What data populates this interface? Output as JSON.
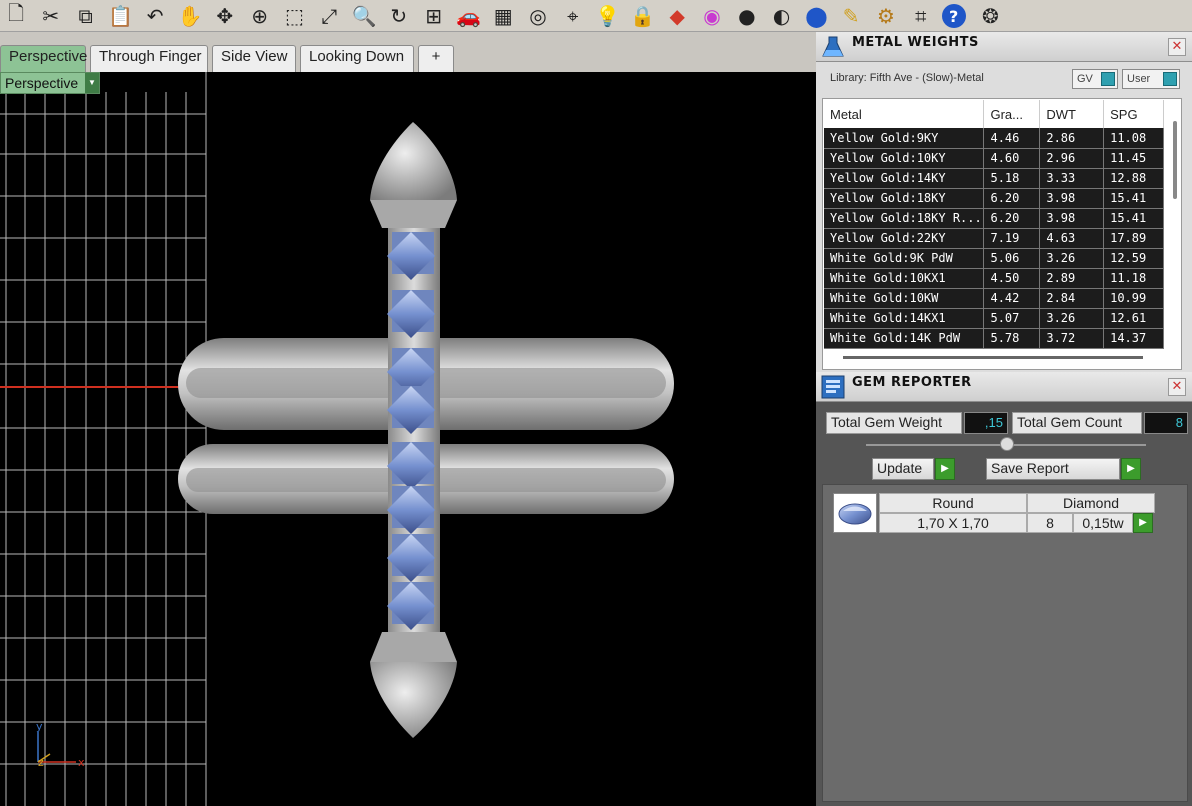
{
  "toolbar": {
    "icons": [
      "new-file-icon",
      "cut-icon",
      "copy-icon",
      "paste-icon",
      "undo-icon",
      "pan-hand-icon",
      "move-icon",
      "zoom-in-icon",
      "zoom-window-icon",
      "zoom-extents-icon",
      "zoom-selected-icon",
      "rotate-view-icon",
      "four-viewports-icon",
      "car-icon",
      "grid-icon",
      "target-icon",
      "snap-icon",
      "bulb-icon",
      "lock-icon",
      "render-icon",
      "color-wheel-icon",
      "sphere-gray-icon",
      "sphere-shaded-icon",
      "sphere-blue-icon",
      "pencil-icon",
      "gear-icon",
      "crop-icon",
      "help-icon",
      "color-palette-icon"
    ]
  },
  "tabs": [
    {
      "label": "Perspective",
      "active": true
    },
    {
      "label": "Through Finger",
      "active": false
    },
    {
      "label": "Side View",
      "active": false
    },
    {
      "label": "Looking Down",
      "active": false
    },
    {
      "label": "+",
      "active": false
    }
  ],
  "viewport": {
    "label": "Perspective",
    "axis_y": "y",
    "axis_x": "x",
    "axis_z": "z"
  },
  "metal_weights": {
    "title": "METAL WEIGHTS",
    "library": "Library: Fifth Ave - (Slow)-Metal",
    "toggle_gv": "GV",
    "toggle_user": "User",
    "columns": [
      "Metal",
      "Gra...",
      "DWT",
      "SPG"
    ],
    "rows": [
      [
        "Yellow Gold:9KY",
        "4.46",
        "2.86",
        "11.08"
      ],
      [
        "Yellow Gold:10KY",
        "4.60",
        "2.96",
        "11.45"
      ],
      [
        "Yellow Gold:14KY",
        "5.18",
        "3.33",
        "12.88"
      ],
      [
        "Yellow Gold:18KY",
        "6.20",
        "3.98",
        "15.41"
      ],
      [
        "Yellow Gold:18KY R...",
        "6.20",
        "3.98",
        "15.41"
      ],
      [
        "Yellow Gold:22KY",
        "7.19",
        "4.63",
        "17.89"
      ],
      [
        "White Gold:9K PdW",
        "5.06",
        "3.26",
        "12.59"
      ],
      [
        "White Gold:10KX1",
        "4.50",
        "2.89",
        "11.18"
      ],
      [
        "White Gold:10KW",
        "4.42",
        "2.84",
        "10.99"
      ],
      [
        "White Gold:14KX1",
        "5.07",
        "3.26",
        "12.61"
      ],
      [
        "White Gold:14K PdW",
        "5.78",
        "3.72",
        "14.37"
      ]
    ]
  },
  "gem_reporter": {
    "title": "GEM REPORTER",
    "total_weight_label": "Total Gem Weight",
    "total_weight_value": ",15",
    "total_count_label": "Total Gem Count",
    "total_count_value": "8",
    "update_label": "Update",
    "save_report_label": "Save Report",
    "gem": {
      "shape": "Round",
      "material": "Diamond",
      "size": "1,70 X 1,70",
      "count": "8",
      "weight": "0,15tw"
    }
  },
  "colors": {
    "accent_green": "#8dc395",
    "viewport_bg": "#000000",
    "gem_blue": "#6f8fd0",
    "metal_gray": "#b5b5b5"
  }
}
